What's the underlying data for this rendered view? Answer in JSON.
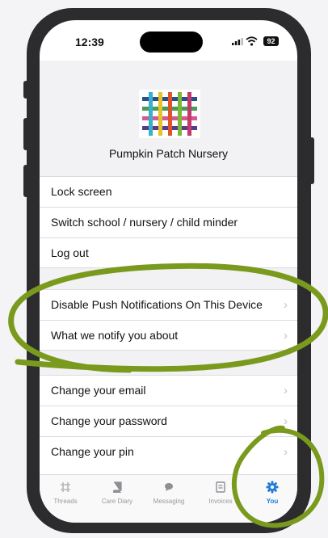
{
  "status_bar": {
    "time": "12:39",
    "battery": "92"
  },
  "school": {
    "name": "Pumpkin Patch Nursery"
  },
  "menu_group_1": [
    {
      "label": "Lock screen"
    },
    {
      "label": "Switch school / nursery / child minder"
    },
    {
      "label": "Log out"
    }
  ],
  "menu_group_2": [
    {
      "label": "Disable Push Notifications On This Device"
    },
    {
      "label": "What we notify you about"
    }
  ],
  "menu_group_3": [
    {
      "label": "Change your email"
    },
    {
      "label": "Change your password"
    },
    {
      "label": "Change your pin"
    }
  ],
  "tabs": [
    {
      "label": "Threads",
      "icon": "threads-icon"
    },
    {
      "label": "Care Diary",
      "icon": "book-icon"
    },
    {
      "label": "Messaging",
      "icon": "chat-bubble-icon"
    },
    {
      "label": "Invoices",
      "icon": "invoice-icon"
    },
    {
      "label": "You",
      "icon": "gear-icon"
    }
  ],
  "colors": {
    "accent": "#1e7bd8",
    "annotation": "#7a9a1e"
  }
}
